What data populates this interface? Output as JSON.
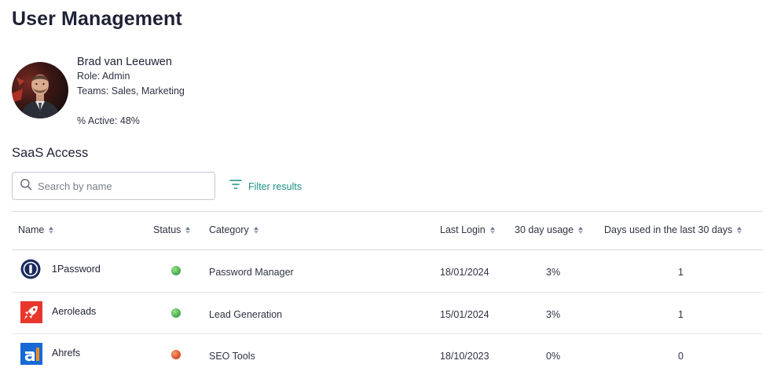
{
  "page": {
    "title": "User Management"
  },
  "user": {
    "name": "Brad van Leeuwen",
    "role": "Role: Admin",
    "teams": "Teams: Sales, Marketing",
    "active": "% Active: 48%"
  },
  "saas": {
    "title": "SaaS Access",
    "search_placeholder": "Search by name",
    "filter_label": "Filter results"
  },
  "table": {
    "headers": {
      "name": "Name",
      "status": "Status",
      "category": "Category",
      "last_login": "Last Login",
      "usage": "30 day usage",
      "days_used": "Days used in the last 30 days"
    },
    "rows": [
      {
        "name": "1Password",
        "logo_icon": "1password-logo-icon",
        "status_color": "#4caf50",
        "category": "Password Manager",
        "last_login": "18/01/2024",
        "usage": "3%",
        "days_used": "1"
      },
      {
        "name": "Aeroleads",
        "logo_icon": "aeroleads-rocket-logo-icon",
        "status_color": "#4caf50",
        "category": "Lead Generation",
        "last_login": "15/01/2024",
        "usage": "3%",
        "days_used": "1"
      },
      {
        "name": "Ahrefs",
        "logo_icon": "ahrefs-logo-icon",
        "status_color": "#e0522a",
        "category": "SEO Tools",
        "last_login": "18/10/2023",
        "usage": "0%",
        "days_used": "0"
      }
    ]
  },
  "colors": {
    "accent": "#1a8f86",
    "status_active": "#4caf50",
    "status_inactive": "#e0522a"
  }
}
